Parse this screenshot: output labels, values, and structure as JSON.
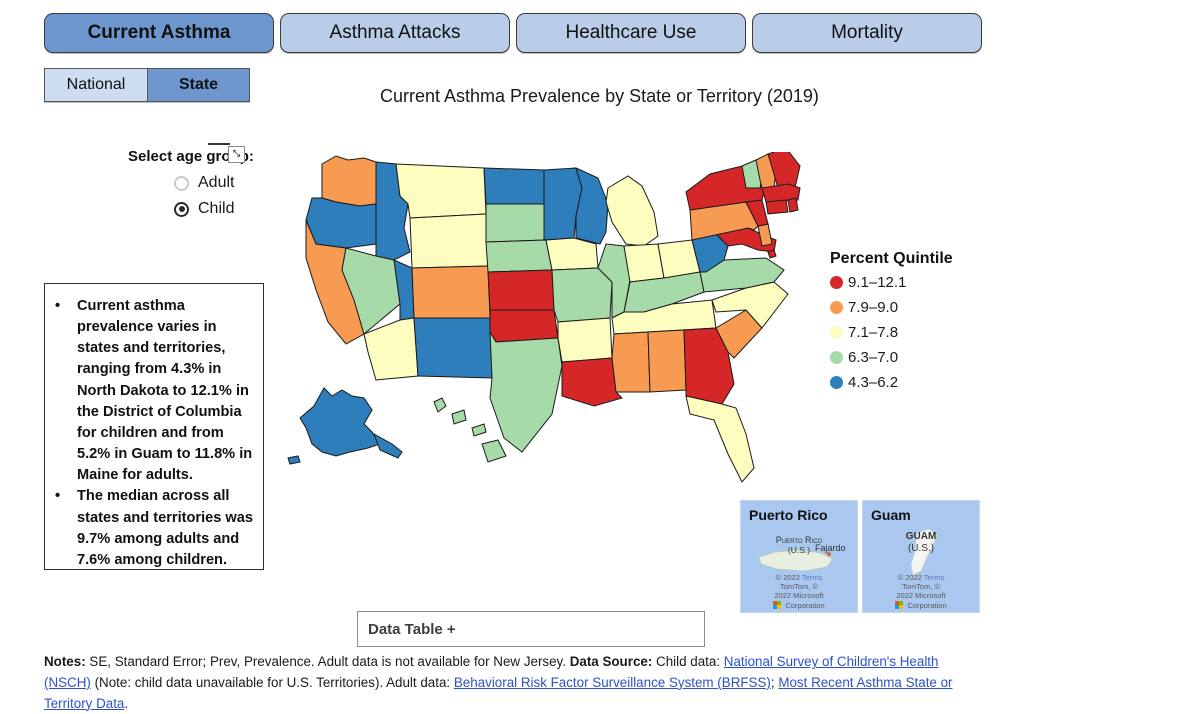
{
  "tabs": [
    {
      "label": "Current Asthma",
      "active": true
    },
    {
      "label": "Asthma Attacks",
      "active": false
    },
    {
      "label": "Healthcare Use",
      "active": false
    },
    {
      "label": "Mortality",
      "active": false
    }
  ],
  "geo_toggle": {
    "national_label": "National",
    "state_label": "State",
    "selected": "State"
  },
  "chart_title": "Current Asthma Prevalence by State or Territory (2019)",
  "age_group": {
    "label": "Select age group:",
    "expand_icon_glyph": "⤡",
    "options": [
      {
        "label": "Adult",
        "selected": false
      },
      {
        "label": "Child",
        "selected": true
      }
    ]
  },
  "findings": {
    "bullet_glyph": "•",
    "items": [
      "Current asthma prevalence varies in states and territories, ranging from 4.3% in North Dakota to 12.1% in the District of Columbia for children and from 5.2% in Guam to 11.8% in Maine for adults.",
      "The median across all states and territories was 9.7% among adults and 7.6% among children."
    ]
  },
  "legend": {
    "title": "Percent Quintile",
    "entries": [
      {
        "label": "9.1–12.1",
        "color": "#d62728"
      },
      {
        "label": "7.9–9.0",
        "color": "#f79a52"
      },
      {
        "label": "7.1–7.8",
        "color": "#fdfdc0"
      },
      {
        "label": "6.3–7.0",
        "color": "#a6dba9"
      },
      {
        "label": "4.3–6.2",
        "color": "#2e7ebb"
      }
    ]
  },
  "insets": [
    {
      "title": "Puerto Rico",
      "place_name": "Puerto Rico",
      "place_sub": "(U.S.)",
      "city_label": "Fajardo",
      "copyright": "© 2022",
      "terms": "Terms",
      "provider_line1": "TomTom, ©",
      "provider_line2": "2022 Microsoft",
      "provider_line3": "Corporation"
    },
    {
      "title": "Guam",
      "place_name": "GUAM",
      "place_sub": "(U.S.)",
      "city_label": "",
      "copyright": "© 2022",
      "terms": "Terms",
      "provider_line1": "TomTom, ©",
      "provider_line2": "2022 Microsoft",
      "provider_line3": "Corporation"
    }
  ],
  "data_table": {
    "label": "Data Table +"
  },
  "notes": {
    "notes_label": "Notes:",
    "notes_text": " SE, Standard Error; Prev, Prevalence. Adult data is not available for New Jersey. ",
    "source_label": "Data Source:",
    "source_text_1": " Child data: ",
    "link_1": "National Survey of Children's Health (NSCH)",
    "source_text_2": " (Note: child data unavailable for U.S. Territories). Adult data: ",
    "link_2": "Behavioral Risk Factor Surveillance System (BRFSS)",
    "source_text_3": "; ",
    "link_3": "Most Recent Asthma State or Territory Data",
    "source_text_4": "."
  },
  "chart_data": {
    "type": "map",
    "title": "Current Asthma Prevalence by State or Territory (2019)",
    "measure": "Current asthma prevalence (percent), children",
    "year": 2019,
    "value_unit": "percent",
    "quintile_bins": [
      {
        "label": "9.1–12.1",
        "color": "#d62728",
        "min": 9.1,
        "max": 12.1
      },
      {
        "label": "7.9–9.0",
        "color": "#f79a52",
        "min": 7.9,
        "max": 9.0
      },
      {
        "label": "7.1–7.8",
        "color": "#fdfdc0",
        "min": 7.1,
        "max": 7.8
      },
      {
        "label": "6.3–7.0",
        "color": "#a6dba9",
        "min": 6.3,
        "max": 7.0
      },
      {
        "label": "4.3–6.2",
        "color": "#2e7ebb",
        "min": 4.3,
        "max": 6.2
      }
    ],
    "range_min": 4.3,
    "range_min_state": "North Dakota",
    "range_max": 12.1,
    "range_max_state": "District of Columbia",
    "median_child": 7.6,
    "median_adult": 9.7,
    "states": {
      "AL": "#f79a52",
      "AK": "#2e7ebb",
      "AZ": "#fdfdc0",
      "AR": "#fdfdc0",
      "CA": "#f79a52",
      "CO": "#f79a52",
      "CT": "#d62728",
      "DE": "#f79a52",
      "DC": "#d62728",
      "FL": "#fdfdc0",
      "GA": "#d62728",
      "HI": "#a6dba9",
      "ID": "#2e7ebb",
      "IL": "#a6dba9",
      "IN": "#fdfdc0",
      "IA": "#fdfdc0",
      "KS": "#d62728",
      "KY": "#a6dba9",
      "LA": "#d62728",
      "ME": "#d62728",
      "MD": "#d62728",
      "MA": "#d62728",
      "MI": "#fdfdc0",
      "MN": "#2e7ebb",
      "MS": "#f79a52",
      "MO": "#a6dba9",
      "MT": "#fdfdc0",
      "NE": "#a6dba9",
      "NV": "#a6dba9",
      "NH": "#f79a52",
      "NJ": "#d62728",
      "NM": "#2e7ebb",
      "NY": "#d62728",
      "NC": "#fdfdc0",
      "ND": "#2e7ebb",
      "OH": "#fdfdc0",
      "OK": "#d62728",
      "OR": "#2e7ebb",
      "PA": "#f79a52",
      "RI": "#d62728",
      "SC": "#f79a52",
      "SD": "#a6dba9",
      "TN": "#fdfdc0",
      "TX": "#a6dba9",
      "UT": "#2e7ebb",
      "VT": "#a6dba9",
      "VA": "#a6dba9",
      "WA": "#f79a52",
      "WV": "#2e7ebb",
      "WI": "#2e7ebb",
      "WY": "#fdfdc0"
    }
  }
}
